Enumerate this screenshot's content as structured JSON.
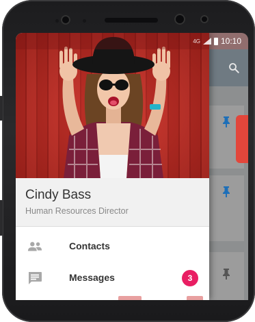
{
  "status_bar": {
    "network": "4G",
    "time": "10:10"
  },
  "drawer": {
    "user": {
      "name": "Cindy Bass",
      "role": "Human Resources Director"
    },
    "menu": [
      {
        "label": "Contacts",
        "icon": "contacts-icon"
      },
      {
        "label": "Messages",
        "icon": "message-icon",
        "badge": "3"
      }
    ]
  },
  "colors": {
    "accent": "#e91e63",
    "fab": "#e2463b",
    "hero_red": "#c0271f"
  }
}
